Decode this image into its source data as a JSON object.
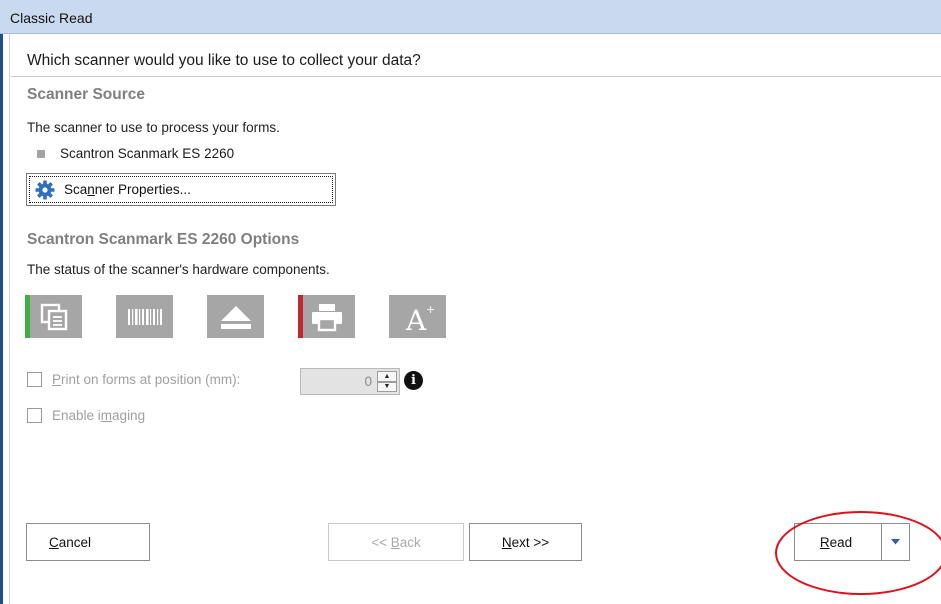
{
  "window": {
    "title": "Classic Read"
  },
  "question": "Which scanner would you like to use to collect your data?",
  "scanner_source": {
    "heading": "Scanner Source",
    "description": "The scanner to use to process your forms.",
    "scanner_name": "Scantron Scanmark ES 2260",
    "properties_button": {
      "pre": "Sca",
      "mnemonic": "n",
      "post": "ner Properties...",
      "icon": "gear-icon"
    }
  },
  "options": {
    "heading": "Scantron Scanmark ES 2260 Options",
    "description": "The status of the scanner's hardware components.",
    "hardware_icons": [
      {
        "name": "scan-pages-icon",
        "status_color": "#3cb043"
      },
      {
        "name": "barcode-icon",
        "status_color": null
      },
      {
        "name": "eject-icon",
        "status_color": null
      },
      {
        "name": "printer-icon",
        "status_color": "#c0282d"
      },
      {
        "name": "text-imaging-icon",
        "status_color": null
      }
    ],
    "print_on_forms": {
      "mnemonic": "P",
      "rest": "rint on forms at position (mm):",
      "checked": false,
      "value": "0"
    },
    "enable_imaging": {
      "pre": "Enable i",
      "mnemonic": "m",
      "post": "aging",
      "checked": false
    }
  },
  "buttons": {
    "cancel": {
      "mnemonic": "C",
      "rest": "ancel"
    },
    "back": {
      "pre": "<< ",
      "mnemonic": "B",
      "post": "ack",
      "enabled": false
    },
    "next": {
      "mnemonic": "N",
      "rest": "ext >>"
    },
    "read": {
      "mnemonic": "R",
      "rest": "ead",
      "dropdown_icon": "chevron-down-icon"
    }
  },
  "annotation": {
    "color": "#e0101a",
    "target": "read-button"
  }
}
